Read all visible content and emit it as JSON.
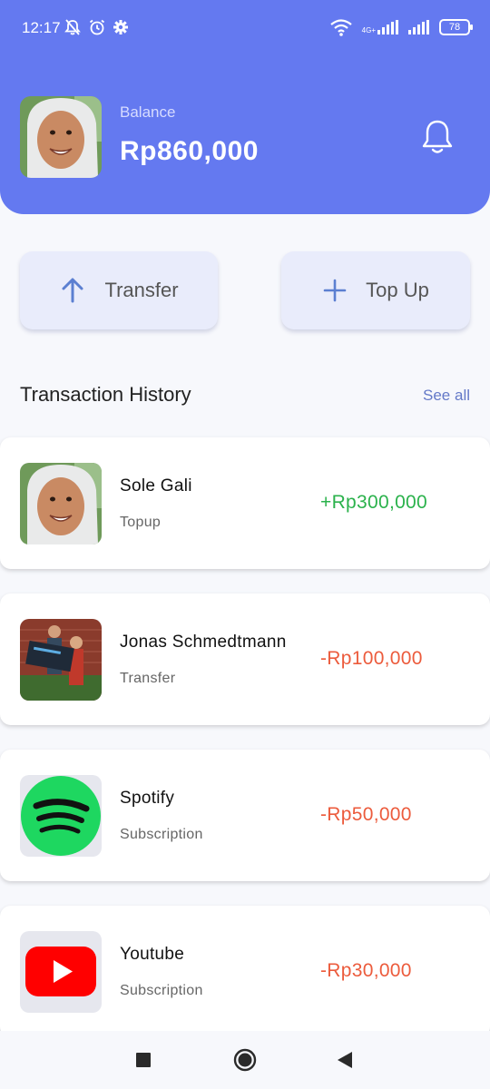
{
  "status_bar": {
    "time": "12:17",
    "network": "4G+",
    "battery": "78"
  },
  "header": {
    "balance_label": "Balance",
    "balance_amount": "Rp860,000"
  },
  "actions": [
    {
      "label": "Transfer",
      "icon": "arrow-up-icon"
    },
    {
      "label": "Top Up",
      "icon": "plus-icon"
    }
  ],
  "history": {
    "title": "Transaction History",
    "see_all": "See all",
    "items": [
      {
        "name": "Sole Gali",
        "type": "Topup",
        "amount": "+Rp300,000",
        "direction": "in"
      },
      {
        "name": "Jonas Schmedtmann",
        "type": "Transfer",
        "amount": "-Rp100,000",
        "direction": "out"
      },
      {
        "name": "Spotify",
        "type": "Subscription",
        "amount": "-Rp50,000",
        "direction": "out"
      },
      {
        "name": "Youtube",
        "type": "Subscription",
        "amount": "-Rp30,000",
        "direction": "out"
      }
    ]
  },
  "colors": {
    "primary": "#6479f0",
    "income": "#2bb24c",
    "expense": "#ec5b3c"
  }
}
